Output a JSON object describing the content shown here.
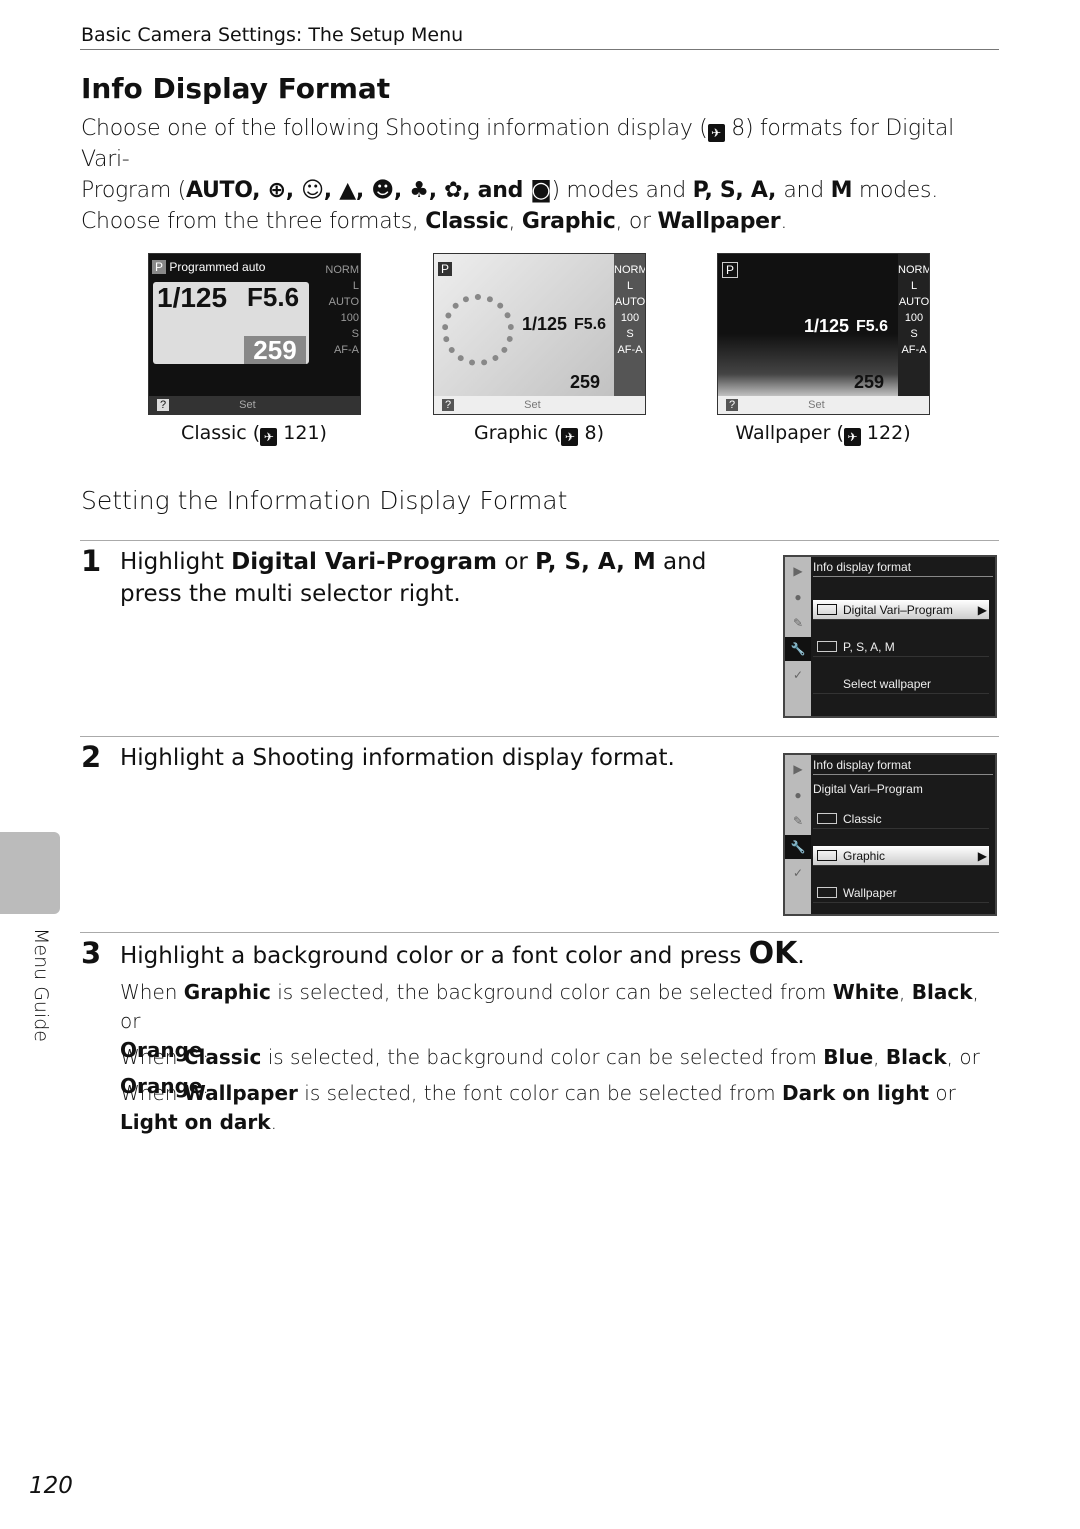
{
  "header": {
    "section": "Basic Camera Settings: The Setup Menu"
  },
  "title": "Info Display Format",
  "intro": {
    "line1_a": "Choose one of the following Shooting information display (",
    "line1_ref": "8",
    "line1_b": ") formats for Digital Vari-",
    "line2_a": "Program (",
    "line2_modes": "AUTO, ⊕, ☺, ▲, ☻, ♣, ✿, and ◙",
    "line2_b": ") modes and ",
    "line2_psa": "P, S, A, ",
    "line2_and": "and ",
    "line2_m": "M",
    "line2_c": " modes.",
    "line3_a": "Choose from the three formats, ",
    "classic": "Classic",
    "graphic": "Graphic",
    "or": ", or ",
    "wallpaper": "Wallpaper",
    "end": "."
  },
  "screens": [
    {
      "caption": "Classic (",
      "ref": "121",
      "mode": "P",
      "mode_label": "Programmed auto",
      "shutter": "1/125",
      "aperture": "F5.6",
      "frames": "259",
      "footer": "Set"
    },
    {
      "caption": "Graphic (",
      "ref": "8",
      "mode": "P",
      "shutter": "1/125",
      "aperture": "F5.6",
      "frames": "259",
      "footer": "Set"
    },
    {
      "caption": "Wallpaper (",
      "ref": "122",
      "mode": "P",
      "shutter": "1/125",
      "aperture": "F5.6",
      "frames": "259",
      "footer": "Set"
    }
  ],
  "side_info": [
    "NORM",
    "L",
    "AUTO",
    "100",
    "S",
    "AF-A"
  ],
  "subheading": "Setting the Information Display Format",
  "steps": [
    {
      "num": "1",
      "t_a": "Highlight ",
      "t_b1": "Digital Vari-Program",
      "t_c": " or ",
      "t_b2": "P, S, A, M",
      "t_d": " and press the multi selector right."
    },
    {
      "num": "2",
      "text": "Highlight a Shooting information display format."
    },
    {
      "num": "3",
      "t_a": "Highlight a background color or a font color and press ",
      "t_ok": "OK",
      "t_end": "."
    }
  ],
  "menu1": {
    "title": "Info display format",
    "items": [
      "Digital Vari–Program",
      "P, S, A, M",
      "Select wallpaper"
    ],
    "selected": 0
  },
  "menu2": {
    "title": "Info display format",
    "subtitle": "Digital Vari–Program",
    "items": [
      "Classic",
      "Graphic",
      "Wallpaper"
    ],
    "selected": 1
  },
  "step3_paras": {
    "p1": {
      "a": "When ",
      "b1": "Graphic",
      "c": " is selected, the background color can be selected from ",
      "b2": "White",
      "d": ", ",
      "b3": "Black",
      "e": ", or ",
      "b4": "Orange",
      "f": "."
    },
    "p2": {
      "a": "When ",
      "b1": "Classic",
      "c": " is selected, the background color can be selected from ",
      "b2": "Blue",
      "d": ", ",
      "b3": "Black",
      "e": ", or ",
      "b4": "Orange",
      "f": "."
    },
    "p3": {
      "a": "When ",
      "b1": "Wallpaper",
      "c": " is selected, the font color can be selected from ",
      "b2": "Dark on light",
      "d": " or ",
      "b3": "Light on dark",
      "f": "."
    }
  },
  "side_tab": "Menu Guide",
  "page_number": "120"
}
